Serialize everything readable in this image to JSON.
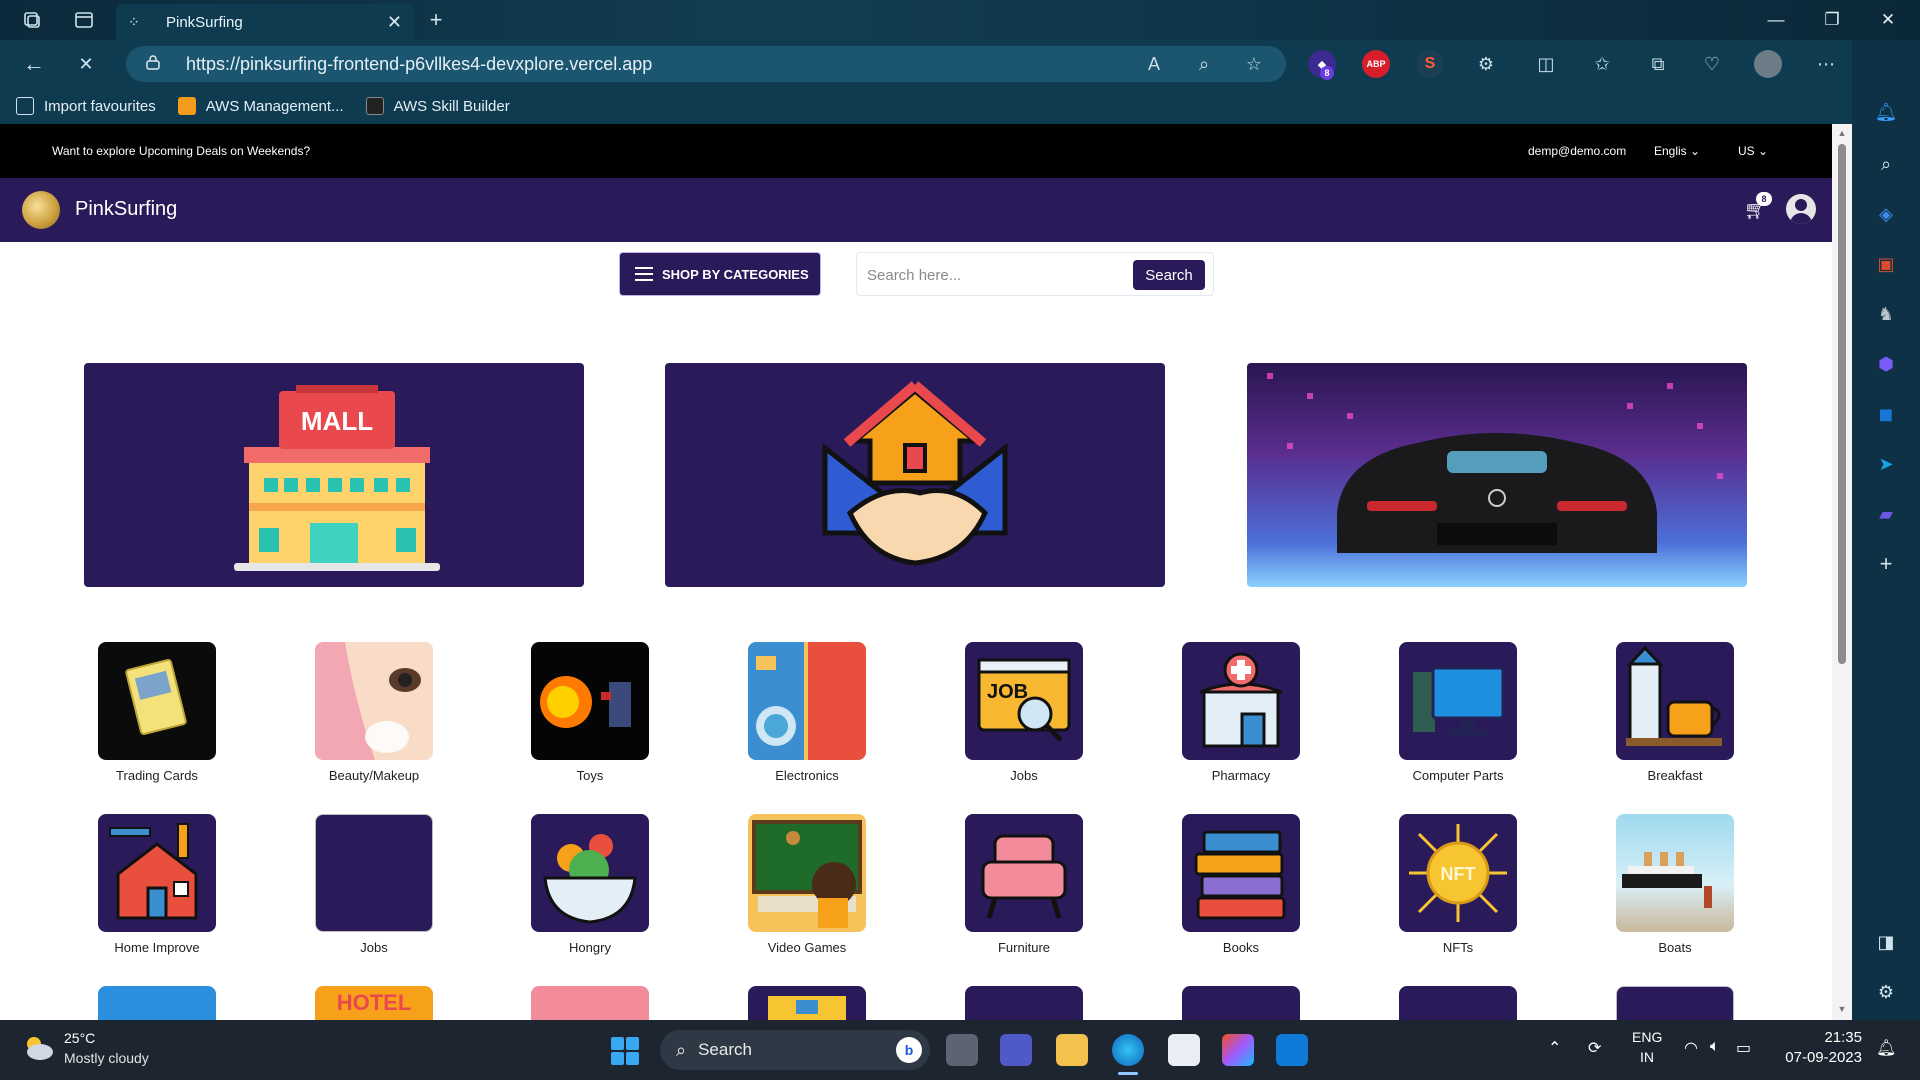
{
  "browser": {
    "tab_title": "PinkSurfing",
    "url": "https://pinksurfing-frontend-p6vllkes4-devxplore.vercel.app",
    "extension_badge": "8",
    "extension_abp": "ABP",
    "favourites": [
      {
        "label": "Import favourites"
      },
      {
        "label": "AWS Management..."
      },
      {
        "label": "AWS Skill Builder"
      }
    ]
  },
  "page": {
    "promo_message": "Want to explore Upcoming Deals on Weekends?",
    "email": "demp@demo.com",
    "language": "Englis",
    "region": "US",
    "brand": "PinkSurfing",
    "cart_count": "8",
    "shop_by_categories": "SHOP BY CATEGORIES",
    "search_placeholder": "Search here...",
    "search_button": "Search",
    "banner_mall_text": "MALL",
    "categories_row1": [
      {
        "label": "Trading Cards"
      },
      {
        "label": "Beauty/Makeup"
      },
      {
        "label": "Toys"
      },
      {
        "label": "Electronics"
      },
      {
        "label": "Jobs"
      },
      {
        "label": "Pharmacy"
      },
      {
        "label": "Computer Parts"
      },
      {
        "label": "Breakfast"
      }
    ],
    "categories_row2": [
      {
        "label": "Home Improve"
      },
      {
        "label": "Jobs"
      },
      {
        "label": "Hongry"
      },
      {
        "label": "Video Games"
      },
      {
        "label": "Furniture"
      },
      {
        "label": "Books"
      },
      {
        "label": "NFTs"
      },
      {
        "label": "Boats"
      }
    ],
    "jobs_tile_text": "JOB",
    "nft_tile_text": "NFT",
    "hotel_tile_text": "HOTEL"
  },
  "taskbar": {
    "temperature": "25°C",
    "weather": "Mostly cloudy",
    "search_label": "Search",
    "lang": "ENG",
    "region": "IN",
    "time": "21:35",
    "date": "07-09-2023"
  }
}
